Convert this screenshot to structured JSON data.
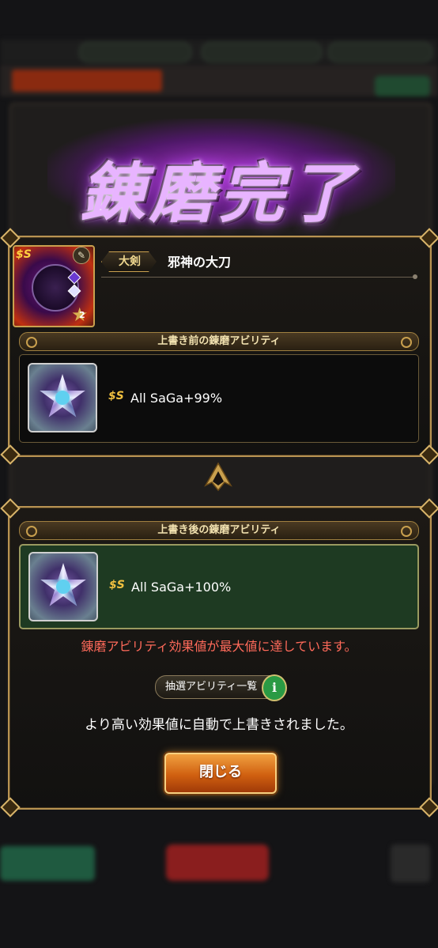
{
  "title": "錬磨完了",
  "weapon": {
    "type": "大剣",
    "name": "邪神の大刀",
    "rank_stars": "2"
  },
  "before_section": {
    "label": "上書き前の錬磨アビリティ",
    "ability_text": "All SaGa+99%"
  },
  "after_section": {
    "label": "上書き後の錬磨アビリティ",
    "ability_text": "All SaGa+100%"
  },
  "warning_text": "錬磨アビリティ効果値が最大値に達しています。",
  "lottery_list_button": "抽選アビリティ一覧",
  "info_icon_glyph": "i",
  "result_message": "より高い効果値に自動で上書きされました。",
  "close_button": "閉じる",
  "colors": {
    "accent_gold": "#c9a04e",
    "warning_red": "#ff6a5a",
    "title_purple": "#c048ff",
    "after_box_green": "#1e3a22",
    "close_button_orange": "#d06010"
  },
  "icons": {
    "saga_badge": "saga-icon",
    "sword": "sword-icon",
    "info": "info-icon",
    "ornament": "crest-arrow-icon"
  }
}
